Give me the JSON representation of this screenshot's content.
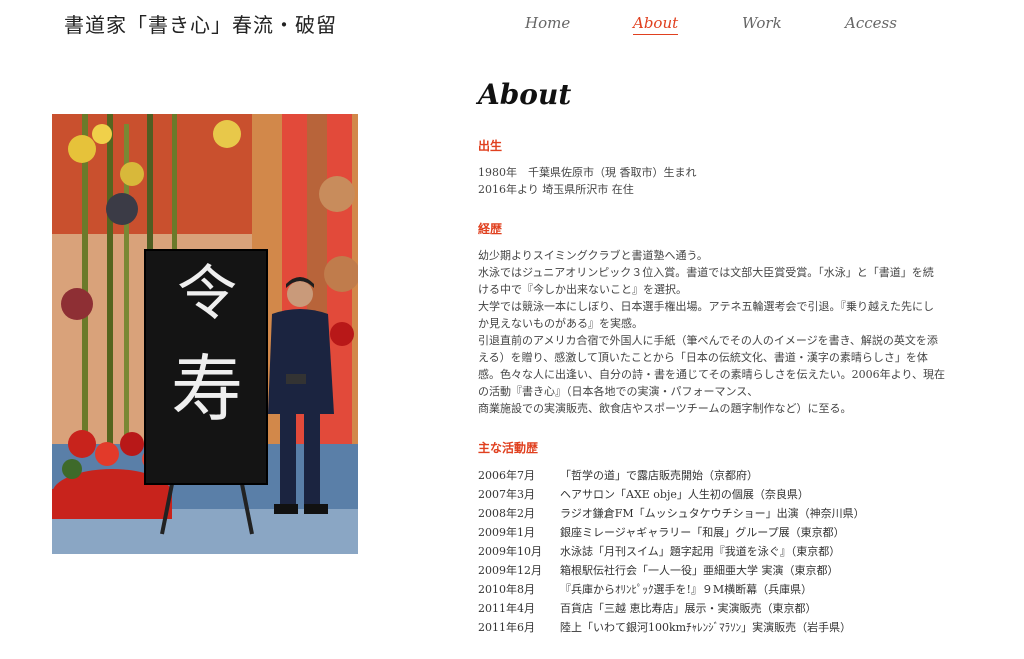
{
  "site": {
    "title": "書道家「書き心」春流・破留"
  },
  "nav": [
    {
      "label": "Home",
      "active": false
    },
    {
      "label": "About",
      "active": true
    },
    {
      "label": "Work",
      "active": false
    },
    {
      "label": "Access",
      "active": false
    }
  ],
  "photo": {
    "calligraphy_text": "令寿"
  },
  "main": {
    "title": "About",
    "birth": {
      "heading": "出生",
      "lines": [
        "1980年　千葉県佐原市（現 香取市）生まれ",
        "2016年より 埼玉県所沢市 在住"
      ]
    },
    "career": {
      "heading": "経歴",
      "lines": [
        "幼少期よりスイミングクラブと書道塾へ通う。",
        "水泳ではジュニアオリンピック３位入賞。書道では文部大臣賞受賞。「水泳」と「書道」を続",
        "ける中で『今しか出来ないこと』を選択。",
        "大学では競泳一本にしぼり、日本選手権出場。アテネ五輪選考会で引退。『乗り越えた先にし",
        "か見えないものがある』を実感。",
        "引退直前のアメリカ合宿で外国人に手紙（筆ぺんでその人のイメージを書き、解説の英文を添",
        "える）を贈り、感激して頂いたことから「日本の伝統文化、書道・漢字の素晴らしさ」を体",
        "感。色々な人に出逢い、自分の詩・書を通じてその素晴らしさを伝えたい。2006年より、現在",
        "の活動『書き心』（日本各地での実演・パフォーマンス、",
        "商業施設での実演販売、飲食店やスポーツチームの題字制作など）に至る。"
      ]
    },
    "activities": {
      "heading": "主な活動歴",
      "items": [
        {
          "date": "2006年7月",
          "text": "「哲学の道」で露店販売開始（京都府）"
        },
        {
          "date": "2007年3月",
          "text": "ヘアサロン「AXE obje」人生初の個展（奈良県）"
        },
        {
          "date": "2008年2月",
          "text": "ラジオ鎌倉FM「ムッシュタケウチショー」出演（神奈川県）"
        },
        {
          "date": "2009年1月",
          "text": "銀座ミレージャギャラリー「和展」グループ展（東京都）"
        },
        {
          "date": "2009年10月",
          "text": "水泳誌「月刊スイム」題字起用『我道を泳ぐ』（東京都）"
        },
        {
          "date": "2009年12月",
          "text": "箱根駅伝社行会「一人一役」亜細亜大学 実演（東京都）"
        },
        {
          "date": "2010年8月",
          "text": "『兵庫からｵﾘﾝﾋﾟｯｸ選手を!』９M横断幕（兵庫県）"
        },
        {
          "date": "2011年4月",
          "text": "百貨店「三越 恵比寿店」展示・実演販売（東京都）"
        },
        {
          "date": "2011年6月",
          "text": "陸上「いわて銀河100kmﾁｬﾚﾝｼﾞﾏﾗｿﾝ」実演販売（岩手県）"
        }
      ]
    }
  }
}
